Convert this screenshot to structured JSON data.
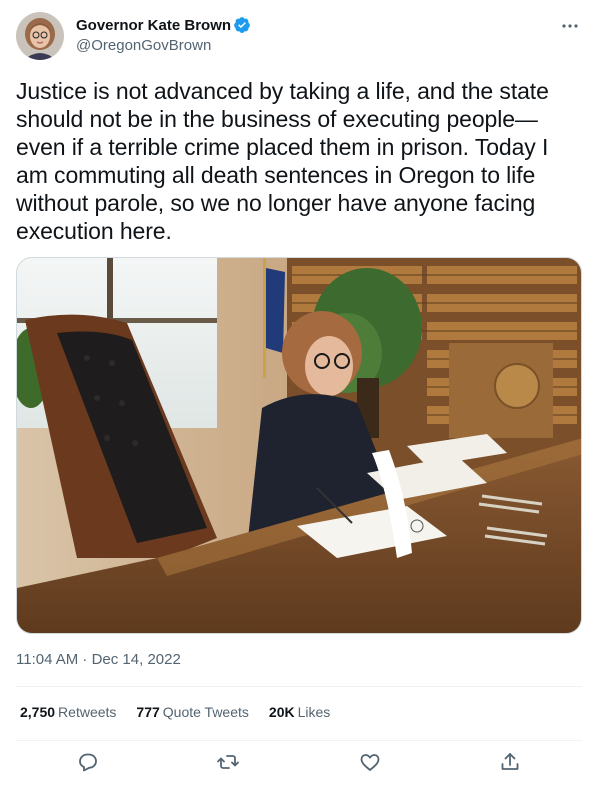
{
  "author": {
    "display_name": "Governor Kate Brown",
    "handle": "@OregonGovBrown",
    "verified": true
  },
  "tweet": {
    "text": "Justice is not advanced by taking a life, and the state should not be in the business of executing people—even if a terrible crime placed them in prison. Today I am commuting all death sentences in Oregon to life without parole, so we no longer have anyone facing execution here.",
    "timestamp": "11:04 AM · Dec 14, 2022"
  },
  "stats": {
    "retweets_count": "2,750",
    "retweets_label": "Retweets",
    "quotes_count": "777",
    "quotes_label": "Quote Tweets",
    "likes_count": "20K",
    "likes_label": "Likes"
  },
  "icons": {
    "verified": "verified-badge-icon",
    "more": "more-options-icon",
    "reply": "reply-icon",
    "retweet": "retweet-icon",
    "like": "like-icon",
    "share": "share-icon"
  },
  "colors": {
    "text_primary": "#0f1419",
    "text_secondary": "#536471",
    "verified_blue": "#1d9bf0",
    "divider": "#eff3f4"
  }
}
